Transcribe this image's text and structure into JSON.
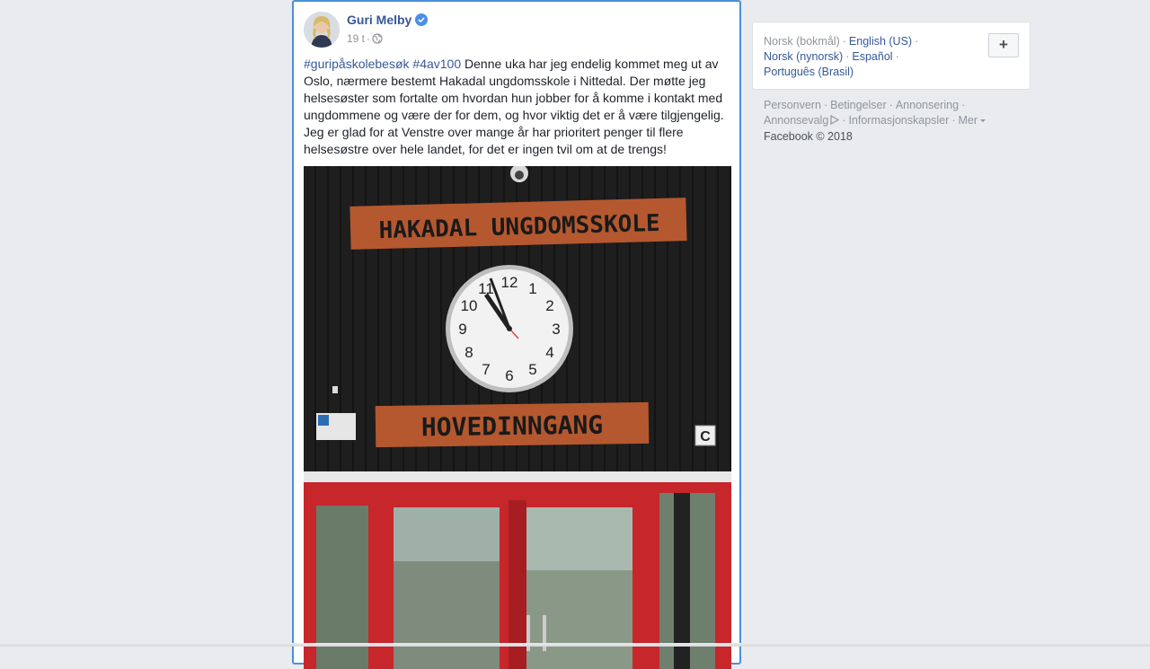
{
  "post": {
    "author": "Guri Melby",
    "time": "19 t",
    "hashtags": [
      "#guripåskolebesøk",
      "#4av100"
    ],
    "body": "Denne uka har jeg endelig kommet meg ut av Oslo, nærmere bestemt Hakadal ungdomsskole i Nittedal. Der møtte jeg helsesøster som fortalte om hvordan hun jobber for å komme i kontakt med ungdommene og være der for dem, og hvor viktig det er å være tilgjengelig. Jeg er glad for at Venstre over mange år har prioritert penger til flere helsesøstre over hele landet, for det er ingen tvil om at de trengs!",
    "image": {
      "sign_top": "HAKADAL UNGDOMSSKOLE",
      "sign_bottom": "HOVEDINNGANG",
      "door_label": "C",
      "clock_numbers": [
        "12",
        "1",
        "2",
        "3",
        "4",
        "5",
        "6",
        "7",
        "8",
        "9",
        "10",
        "11"
      ]
    }
  },
  "languages": {
    "current": "Norsk (bokmål)",
    "options": [
      "English (US)",
      "Norsk (nynorsk)",
      "Español",
      "Português (Brasil)"
    ],
    "add_label": "+"
  },
  "footer": {
    "links": [
      "Personvern",
      "Betingelser",
      "Annonsering",
      "Annonsevalg",
      "Informasjonskapsler",
      "Mer"
    ],
    "copyright": "Facebook © 2018"
  },
  "colors": {
    "link": "#365899",
    "background": "#e9ebee",
    "verified": "#4a90e2"
  }
}
